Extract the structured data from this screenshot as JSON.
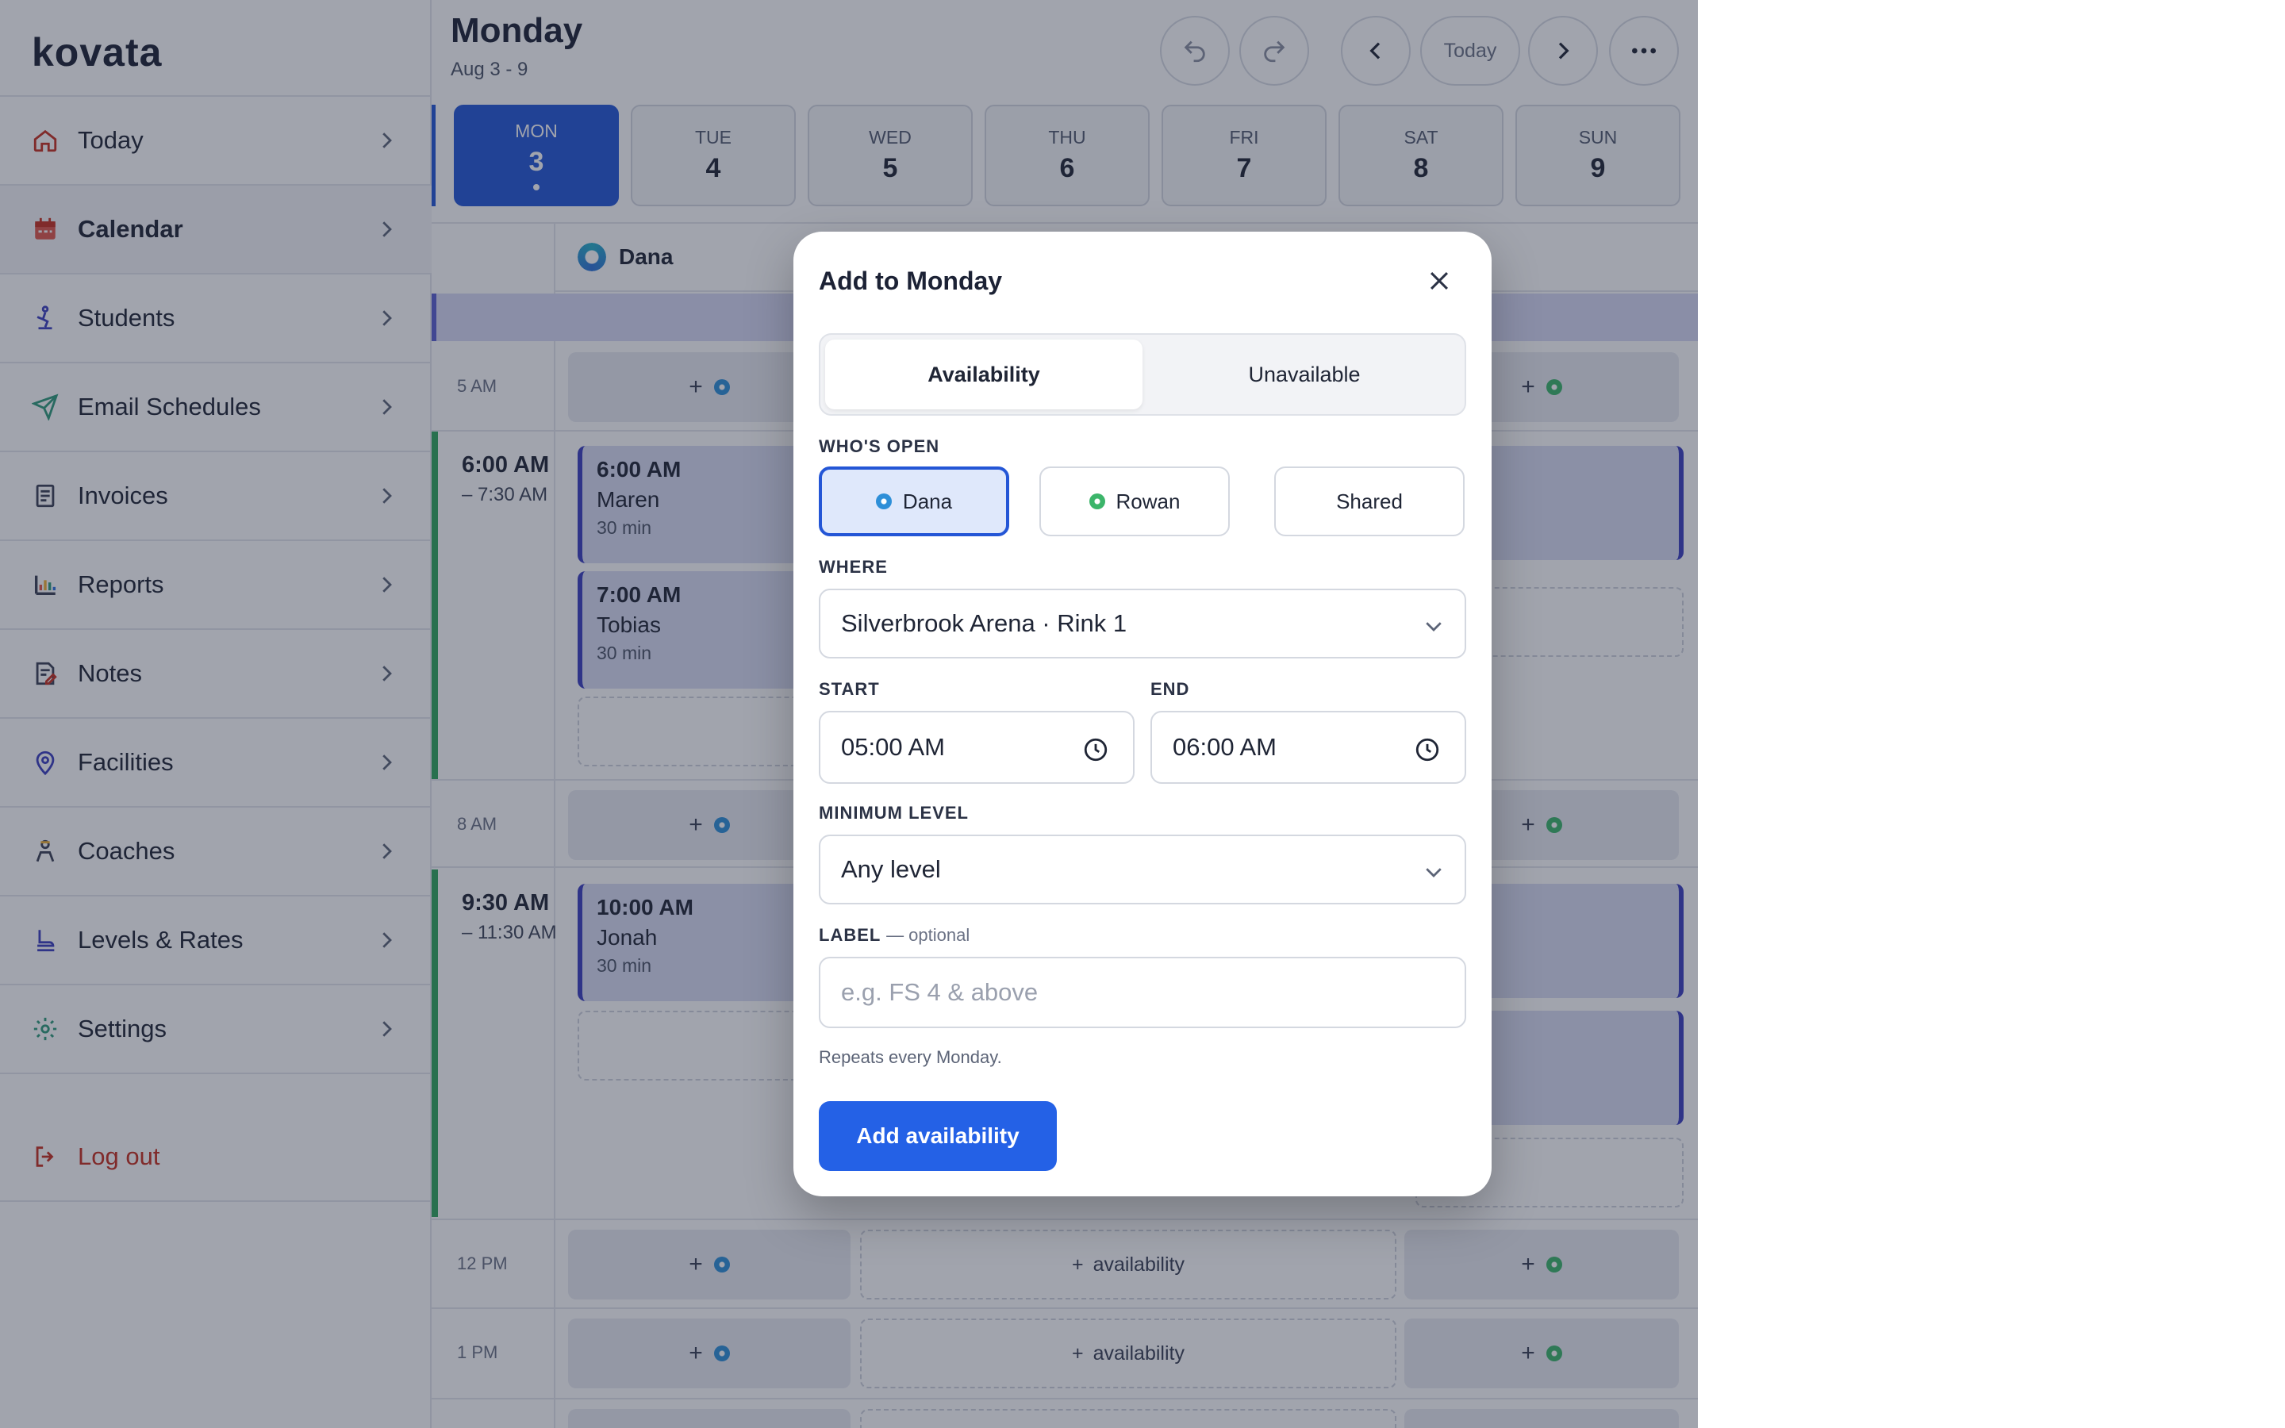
{
  "app": {
    "logo": "kovata"
  },
  "sidebar": {
    "items": [
      {
        "label": "Today",
        "icon": "home-icon"
      },
      {
        "label": "Calendar",
        "icon": "calendar-icon"
      },
      {
        "label": "Students",
        "icon": "skater-icon"
      },
      {
        "label": "Email Schedules",
        "icon": "send-icon"
      },
      {
        "label": "Invoices",
        "icon": "receipt-icon"
      },
      {
        "label": "Reports",
        "icon": "bar-chart-icon"
      },
      {
        "label": "Notes",
        "icon": "notes-icon"
      },
      {
        "label": "Facilities",
        "icon": "location-pin-icon"
      },
      {
        "label": "Coaches",
        "icon": "coach-icon"
      },
      {
        "label": "Levels & Rates",
        "icon": "skate-icon"
      },
      {
        "label": "Settings",
        "icon": "gear-icon"
      }
    ],
    "logout": "Log out"
  },
  "header": {
    "title": "Monday",
    "range": "Aug 3 - 9",
    "today_label": "Today"
  },
  "days": [
    {
      "name": "MON",
      "num": "3"
    },
    {
      "name": "TUE",
      "num": "4"
    },
    {
      "name": "WED",
      "num": "5"
    },
    {
      "name": "THU",
      "num": "6"
    },
    {
      "name": "FRI",
      "num": "7"
    },
    {
      "name": "SAT",
      "num": "8"
    },
    {
      "name": "SUN",
      "num": "9"
    }
  ],
  "calendar": {
    "coach": "Dana",
    "times": {
      "t5": "5 AM",
      "t8": "8 AM",
      "t12": "12 PM",
      "t1": "1 PM"
    },
    "block1": {
      "start": "6:00 AM",
      "end": "– 7:30 AM"
    },
    "block2": {
      "start": "9:30 AM",
      "end": "– 11:30 AM"
    },
    "lessons": [
      {
        "time": "6:00 AM",
        "name": "Maren",
        "dur": "30 min"
      },
      {
        "time": "7:00 AM",
        "name": "Tobias",
        "dur": "30 min"
      },
      {
        "time": "10:00 AM",
        "name": "Jonah",
        "dur": "30 min"
      }
    ],
    "availability_label": "availability",
    "plus": "+"
  },
  "modal": {
    "title": "Add to Monday",
    "tabs": {
      "availability": "Availability",
      "unavailable": "Unavailable"
    },
    "whos_open_label": "WHO'S OPEN",
    "who": {
      "dana": "Dana",
      "rowan": "Rowan",
      "shared": "Shared"
    },
    "where_label": "WHERE",
    "where_value": "Silverbrook Arena · Rink 1",
    "start_label": "START",
    "start_value": "05:00 AM",
    "end_label": "END",
    "end_value": "06:00 AM",
    "level_label": "MINIMUM LEVEL",
    "level_value": "Any level",
    "label_label": "LABEL",
    "label_optional": "— optional",
    "label_placeholder": "e.g. FS 4 & above",
    "hint": "Repeats every Monday.",
    "submit": "Add availability"
  }
}
